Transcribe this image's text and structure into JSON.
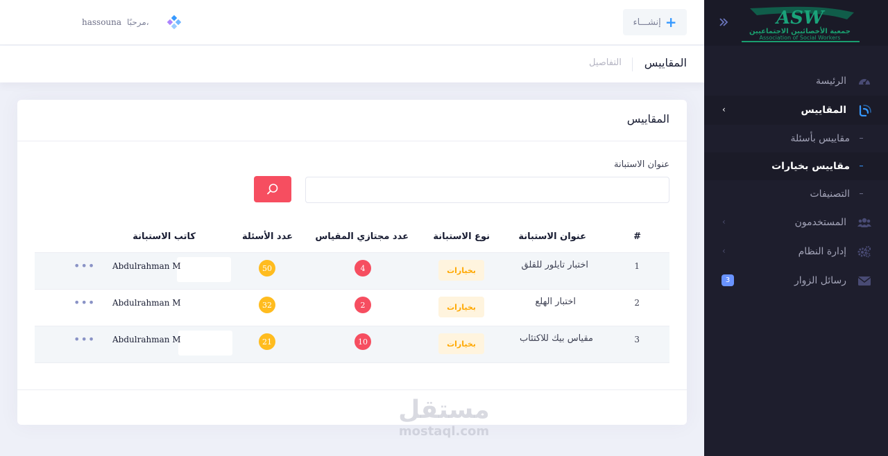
{
  "header": {
    "create_label": "إنشـــاء",
    "user_greeting": "مرحبًا،",
    "user_name": "hassouna"
  },
  "subheader": {
    "title": "المقاييس",
    "breadcrumb": "التفاصيل"
  },
  "sidebar": {
    "logo_text": "ASW",
    "logo_ar": "جمعية الأخصائيين الاجتماعيين",
    "logo_en": "Association of Social Workers",
    "items": [
      {
        "label": "الرئيسة",
        "icon": "dashboard-icon"
      },
      {
        "label": "المقاييس",
        "icon": "scale-icon",
        "open": true
      },
      {
        "label": "المستخدمون",
        "icon": "users-icon"
      },
      {
        "label": "إدارة النظام",
        "icon": "cogs-icon"
      },
      {
        "label": "رسائل الزوار",
        "icon": "envelope-icon",
        "badge": "3"
      }
    ],
    "subitems": [
      {
        "label": "مقاييس بأسئلة"
      },
      {
        "label": "مقاييس بخيارات",
        "active": true
      },
      {
        "label": "التصنيفات"
      }
    ]
  },
  "card": {
    "title": "المقاييس",
    "search_label": "عنوان الاستبانة",
    "search_value": ""
  },
  "table": {
    "columns": [
      "#",
      "عنوان الاستبانة",
      "نوع الاستبانة",
      "عدد مجتازي المقياس",
      "عدد الأسئلة",
      "كاتب الاستبانة"
    ],
    "rows": [
      {
        "num": "1",
        "title": "اختبار تايلور للقلق",
        "type": "بخيارات",
        "passed": "4",
        "questions": "50",
        "author": "Abdulrahman M",
        "actions": "•••"
      },
      {
        "num": "2",
        "title": "اختبار الهلع",
        "type": "بخيارات",
        "passed": "2",
        "questions": "32",
        "author": "Abdulrahman M",
        "actions": "•••"
      },
      {
        "num": "3",
        "title": "مقياس بيك للاكتئاب",
        "type": "بخيارات",
        "passed": "10",
        "questions": "21",
        "author": "Abdulrahman M",
        "actions": "•••"
      }
    ]
  },
  "watermark": {
    "ar": "مستقل",
    "en": "mostaql.com"
  },
  "colors": {
    "sidebar_bg": "#1e1e2d",
    "accent_blue": "#3699ff",
    "danger": "#f64e60",
    "warning": "#ffbc1f",
    "badge_warning_bg": "#fff4de",
    "badge_primary": "#6993ff"
  }
}
